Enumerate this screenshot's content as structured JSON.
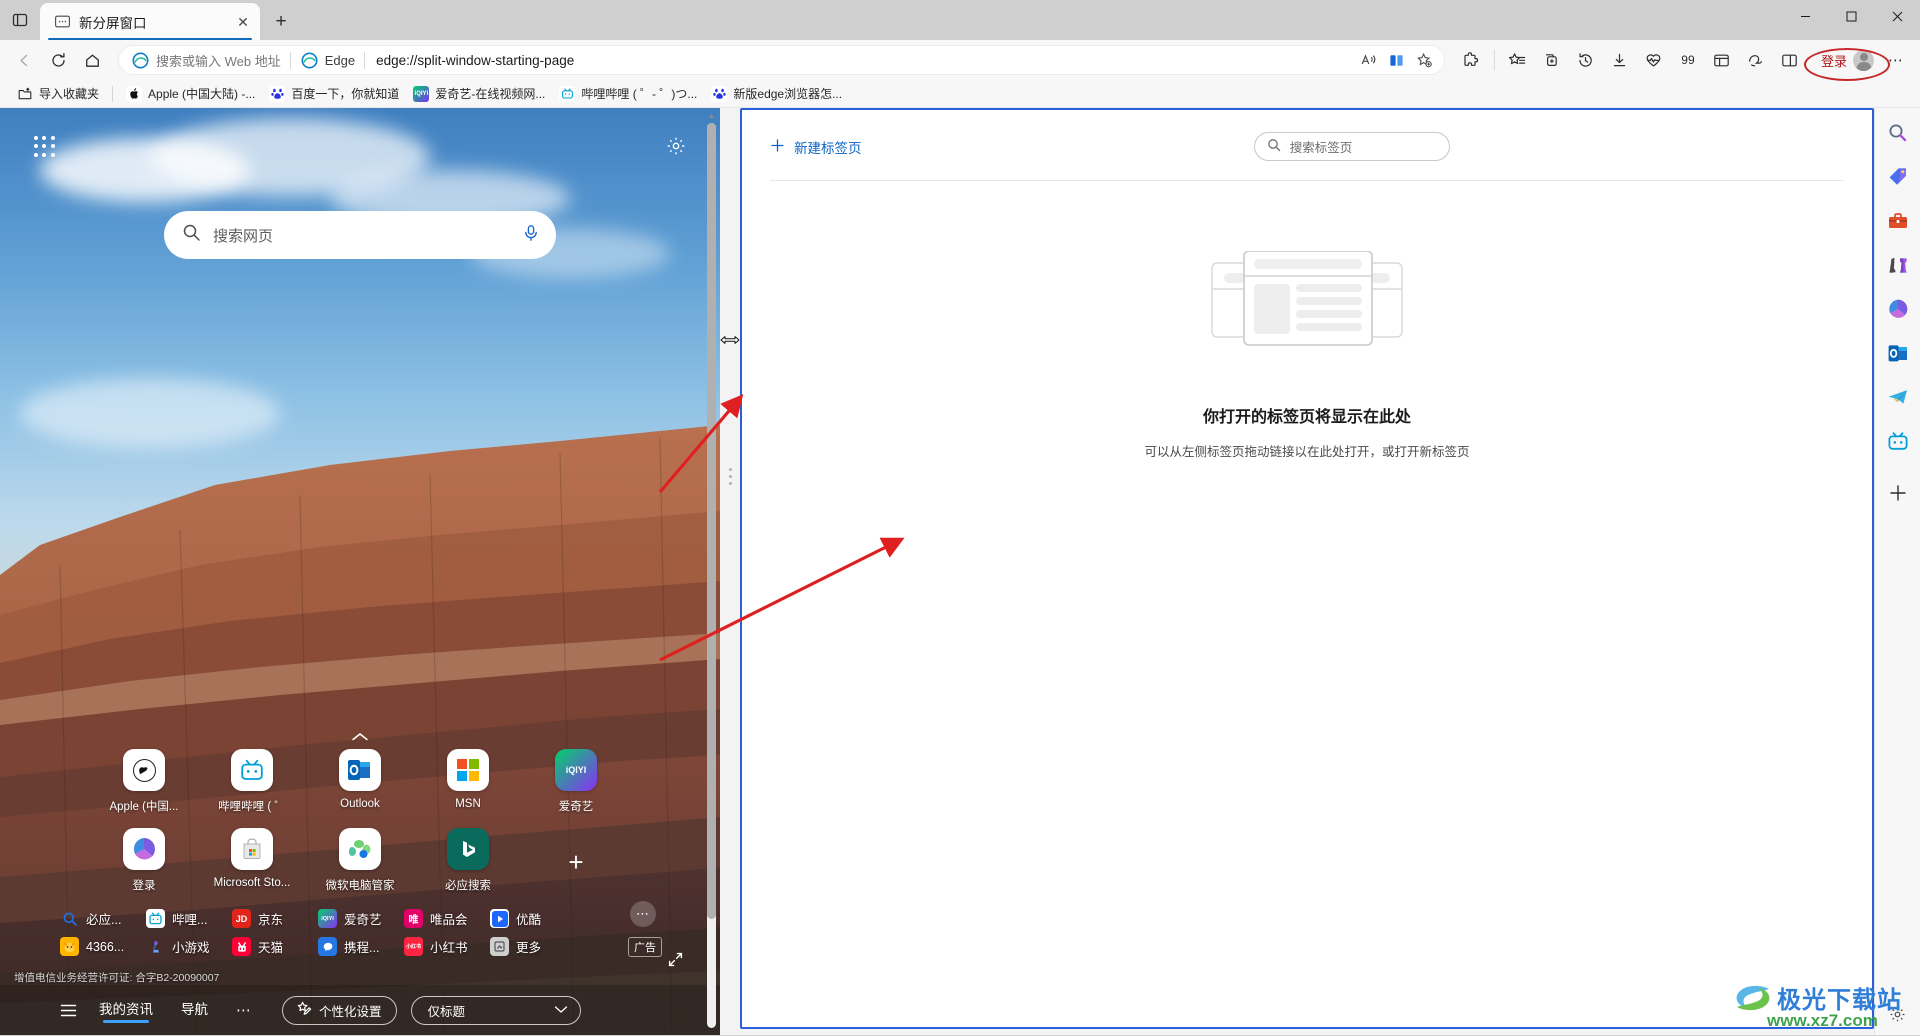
{
  "window": {
    "minimize_label": "─",
    "maximize_label": "❐",
    "close_label": "✕"
  },
  "tabstrip": {
    "tab_search_icon": "tab-actions-icon",
    "tabs": [
      {
        "title": "新分屏窗口",
        "favicon": "split-window-icon",
        "active": true,
        "close_label": "✕"
      }
    ],
    "new_tab_label": "+"
  },
  "toolbar": {
    "back_label": "←",
    "refresh_label": "↻",
    "home_label": "⌂",
    "omnibox": {
      "search_placeholder": "搜索或输入 Web 地址",
      "engine_label": "Edge",
      "url": "edge://split-window-starting-page",
      "read_aloud_icon": "read-aloud-icon",
      "split_screen_icon": "split-screen-icon",
      "favorite_icon": "add-favorite-icon"
    },
    "icons": [
      {
        "name": "extensions-icon"
      },
      {
        "name": "collections-icon"
      },
      {
        "name": "browser-essentials-icon"
      },
      {
        "name": "history-icon"
      },
      {
        "name": "downloads-icon"
      },
      {
        "name": "performance-icon"
      },
      {
        "name": "copilot-99-icon",
        "label": "99"
      },
      {
        "name": "workspaces-icon"
      },
      {
        "name": "copilot-icon"
      },
      {
        "name": "split-screen-toggle-icon"
      }
    ],
    "login_label": "登录",
    "settings_more_label": "⋯"
  },
  "bookmarks": {
    "import_label": "导入收藏夹",
    "items": [
      {
        "label": "Apple (中国大陆) -...",
        "favicon": "apple-icon",
        "color": "#111111"
      },
      {
        "label": "百度一下，你就知道",
        "favicon": "baidu-icon",
        "color": "#2932e1"
      },
      {
        "label": "爱奇艺-在线视频网...",
        "favicon": "iqiyi-icon",
        "color": "#00be06"
      },
      {
        "label": "哔哩哔哩 ( ゜- ゜)つ...",
        "favicon": "bilibili-icon",
        "color": "#00a1d6"
      },
      {
        "label": "新版edge浏览器怎...",
        "favicon": "baidu-icon",
        "color": "#2932e1"
      }
    ]
  },
  "new_tab_page": {
    "apps_grid_icon": "apps-grid-icon",
    "settings_icon": "page-settings-gear-icon",
    "search_placeholder": "搜索网页",
    "search_icon": "search-icon",
    "mic_icon": "microphone-icon",
    "collapse_icon": "chevron-up-icon",
    "shortcuts": [
      {
        "label": "Apple (中国...",
        "icon": "apple-icon"
      },
      {
        "label": "哔哩哔哩 ( ゜",
        "icon": "bilibili-icon"
      },
      {
        "label": "Outlook",
        "icon": "outlook-icon"
      },
      {
        "label": "MSN",
        "icon": "msn-icon"
      },
      {
        "label": "爱奇艺",
        "icon": "iqiyi-icon"
      },
      {
        "label": "登录",
        "icon": "microsoft365-icon"
      },
      {
        "label": "Microsoft Sto...",
        "icon": "microsoft-store-icon"
      },
      {
        "label": "微软电脑管家",
        "icon": "pc-manager-icon"
      },
      {
        "label": "必应搜索",
        "icon": "bing-icon"
      }
    ],
    "add_shortcut_label": "+",
    "quicklinks_row1": [
      {
        "label": "必应...",
        "icon": "bing-search-icon"
      },
      {
        "label": "哔哩...",
        "icon": "bilibili-icon"
      },
      {
        "label": "京东",
        "icon": "jd-icon"
      },
      {
        "label": "爱奇艺",
        "icon": "iqiyi-icon"
      },
      {
        "label": "唯品会",
        "icon": "vip-icon"
      },
      {
        "label": "优酷",
        "icon": "youku-icon"
      }
    ],
    "quicklinks_row2": [
      {
        "label": "4366...",
        "icon": "game4366-icon"
      },
      {
        "label": "小游戏",
        "icon": "minigame-icon"
      },
      {
        "label": "天猫",
        "icon": "tmall-icon"
      },
      {
        "label": "携程...",
        "icon": "ctrip-icon"
      },
      {
        "label": "小红书",
        "icon": "xiaohongshu-icon"
      },
      {
        "label": "更多",
        "icon": "more-icon"
      }
    ],
    "more_dots_label": "⋯",
    "ad_badge_label": "广告",
    "license_text": "增值电信业务经营许可证: 合字B2-20090007",
    "expand_icon": "expand-icon",
    "bottom_bar": {
      "hamburger_icon": "feed-layout-icon",
      "tabs": [
        {
          "label": "我的资讯",
          "active": true
        },
        {
          "label": "导航",
          "active": false
        }
      ],
      "more_label": "⋯",
      "personalize_label": "个性化设置",
      "personalize_icon": "pencil-star-icon",
      "layout_value": "仅标题",
      "chevron_icon": "chevron-down-icon"
    }
  },
  "split_pane": {
    "new_tab_label": "新建标签页",
    "new_tab_icon": "plus-icon",
    "search_placeholder": "搜索标签页",
    "search_icon": "search-icon",
    "empty_title": "你打开的标签页将显示在此处",
    "empty_subtitle": "可以从左侧标签页拖动链接以在此处打开，或打开新标签页",
    "illustration_icon": "empty-tabs-illustration"
  },
  "edge_sidebar": {
    "items": [
      {
        "name": "sidebar-search-icon"
      },
      {
        "name": "sidebar-shopping-icon"
      },
      {
        "name": "sidebar-tools-icon"
      },
      {
        "name": "sidebar-games-icon"
      },
      {
        "name": "sidebar-microsoft365-icon"
      },
      {
        "name": "sidebar-outlook-icon"
      },
      {
        "name": "sidebar-telegram-icon"
      },
      {
        "name": "sidebar-bilibili-icon"
      }
    ],
    "add_label": "+",
    "settings_icon": "sidebar-settings-gear-icon"
  },
  "watermark": {
    "title": "极光下载站",
    "url": "www.xz7.com"
  },
  "colors": {
    "accent_blue": "#2b5fd9",
    "link_blue": "#0b63c5",
    "tab_underline": "#0f6cbd",
    "annotation_red": "#e02020",
    "login_red": "#b11818"
  }
}
